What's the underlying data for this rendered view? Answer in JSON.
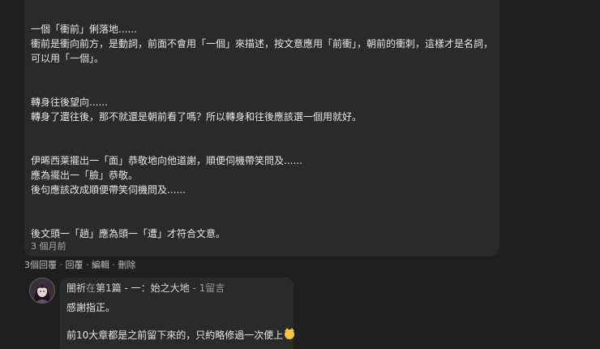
{
  "comment": {
    "paragraphs": [
      [
        "一個「衝前」俐落地......",
        "衝前是衝向前方，是動詞，前面不會用「一個」來描述，按文意應用「前衝」，朝前的衝刺，這樣才是名詞，",
        "可以用「一個」。"
      ],
      [
        "轉身往後望向......",
        "轉身了還往後，那不就還是朝前看了嗎？所以轉身和往後應該選一個用就好。"
      ],
      [
        "伊晞西莱擺出一「面」恭敬地向他道謝，順便伺機帶笑問及......",
        "應為擺出一「臉」恭敬。",
        "後句應該改成順便帶笑伺機問及......"
      ],
      [
        "後文頭一「趟」應為頭一「遭」才符合文意。"
      ]
    ],
    "timestamp": "3 個月前"
  },
  "actions": {
    "replies": "3個回覆",
    "reply": "回覆",
    "edit": "編輯",
    "delete": "刪除",
    "separator": "·"
  },
  "reply": {
    "author": "闇祈",
    "in_text": "在",
    "chapter": "第1篇 - 一：始之大地",
    "dash": " - ",
    "comment_count": "1留言",
    "lines": [
      "感謝指正。",
      "前10大章都是之前留下來的，只約略修過一次便上"
    ],
    "emoji": "cat-emoji-icon"
  }
}
